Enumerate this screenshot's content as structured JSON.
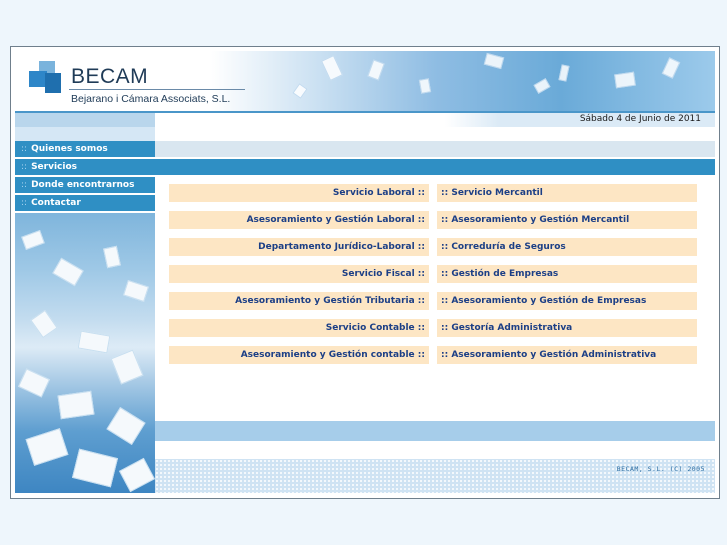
{
  "header": {
    "logo_name": "BECAM",
    "logo_subtitle": "Bejarano i Cámara Associats, S.L."
  },
  "date": "Sábado 4 de Junio de 2011",
  "nav": {
    "separator": "::",
    "items": [
      {
        "label": "Quienes somos",
        "active": false
      },
      {
        "label": "Servicios",
        "active": true
      },
      {
        "label": "Donde encontrarnos",
        "active": false
      },
      {
        "label": "Contactar",
        "active": false
      }
    ]
  },
  "services": {
    "left": [
      "Servicio Laboral ::",
      "Asesoramiento y Gestión Laboral ::",
      "Departamento Jurídico-Laboral ::",
      "Servicio Fiscal ::",
      "Asesoramiento y Gestión Tributaria ::",
      "Servicio Contable ::",
      "Asesoramiento y Gestión contable ::"
    ],
    "right": [
      ":: Servicio Mercantil",
      ":: Asesoramiento y Gestión Mercantil",
      ":: Correduría de Seguros",
      ":: Gestión de Empresas",
      ":: Asesoramiento y Gestión de Empresas",
      ":: Gestoría Administrativa",
      ":: Asesoramiento y Gestión Administrativa"
    ]
  },
  "footer": {
    "copyright": "BECAM, S.L. (C) 2005"
  },
  "colors": {
    "nav_bg": "#2f8fc4",
    "service_bg": "#fde6c4",
    "service_text": "#1c3f86",
    "page_bg": "#eef6fc"
  },
  "icons": [
    "logo-mark-icon"
  ]
}
